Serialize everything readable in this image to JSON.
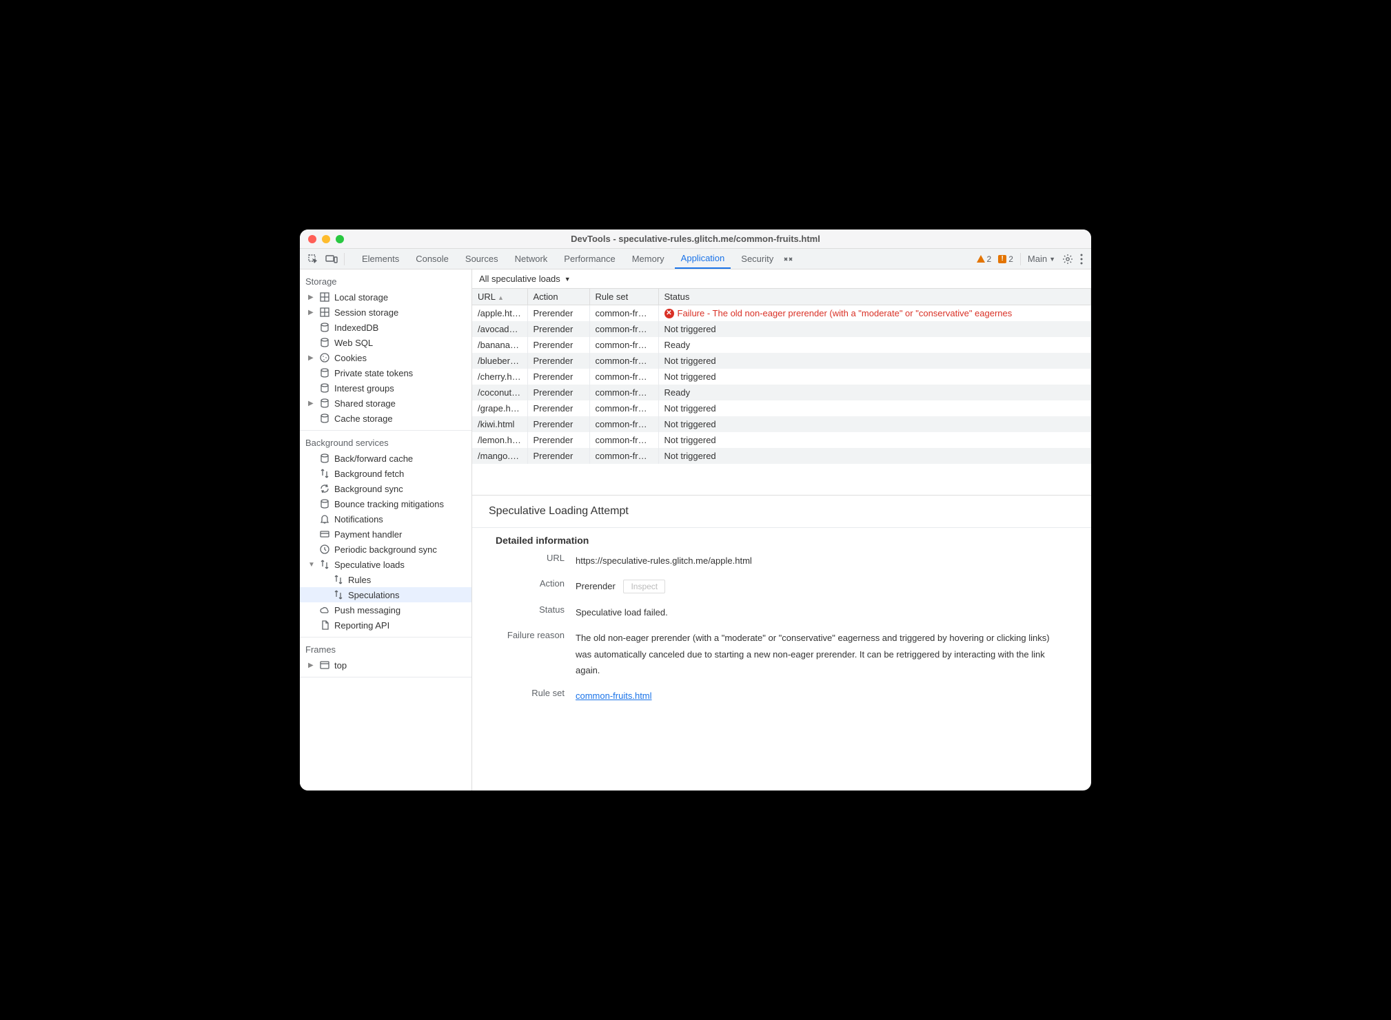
{
  "window_title": "DevTools - speculative-rules.glitch.me/common-fruits.html",
  "tabs": [
    "Elements",
    "Console",
    "Sources",
    "Network",
    "Performance",
    "Memory",
    "Application",
    "Security"
  ],
  "active_tab": "Application",
  "toolbar_right": {
    "warn_count": "2",
    "error_count": "2",
    "target": "Main"
  },
  "sidebar_sections": {
    "storage": {
      "title": "Storage",
      "items": [
        {
          "label": "Local storage",
          "icon": "grid",
          "expandable": true
        },
        {
          "label": "Session storage",
          "icon": "grid",
          "expandable": true
        },
        {
          "label": "IndexedDB",
          "icon": "db"
        },
        {
          "label": "Web SQL",
          "icon": "db"
        },
        {
          "label": "Cookies",
          "icon": "cookie",
          "expandable": true
        },
        {
          "label": "Private state tokens",
          "icon": "db"
        },
        {
          "label": "Interest groups",
          "icon": "db"
        },
        {
          "label": "Shared storage",
          "icon": "db",
          "expandable": true
        },
        {
          "label": "Cache storage",
          "icon": "db"
        }
      ]
    },
    "background": {
      "title": "Background services",
      "items": [
        {
          "label": "Back/forward cache",
          "icon": "db"
        },
        {
          "label": "Background fetch",
          "icon": "updown"
        },
        {
          "label": "Background sync",
          "icon": "sync"
        },
        {
          "label": "Bounce tracking mitigations",
          "icon": "db"
        },
        {
          "label": "Notifications",
          "icon": "bell"
        },
        {
          "label": "Payment handler",
          "icon": "card"
        },
        {
          "label": "Periodic background sync",
          "icon": "clock"
        },
        {
          "label": "Speculative loads",
          "icon": "updown",
          "expandable": true,
          "expanded": true
        },
        {
          "label": "Rules",
          "icon": "updown",
          "nested": true
        },
        {
          "label": "Speculations",
          "icon": "updown",
          "nested": true,
          "selected": true
        },
        {
          "label": "Push messaging",
          "icon": "cloud"
        },
        {
          "label": "Reporting API",
          "icon": "doc"
        }
      ]
    },
    "frames": {
      "title": "Frames",
      "items": [
        {
          "label": "top",
          "icon": "window",
          "expandable": true
        }
      ]
    }
  },
  "filter": "All speculative loads",
  "table": {
    "headers": [
      "URL",
      "Action",
      "Rule set",
      "Status"
    ],
    "rows": [
      {
        "url": "/apple.html",
        "action": "Prerender",
        "ruleset": "common-fr…",
        "status": "Failure - The old non-eager prerender (with a \"moderate\" or \"conservative\" eagernes",
        "failed": true
      },
      {
        "url": "/avocad…",
        "action": "Prerender",
        "ruleset": "common-fr…",
        "status": "Not triggered"
      },
      {
        "url": "/banana.…",
        "action": "Prerender",
        "ruleset": "common-fr…",
        "status": "Ready"
      },
      {
        "url": "/blueberr…",
        "action": "Prerender",
        "ruleset": "common-fr…",
        "status": "Not triggered"
      },
      {
        "url": "/cherry.h…",
        "action": "Prerender",
        "ruleset": "common-fr…",
        "status": "Not triggered"
      },
      {
        "url": "/coconut…",
        "action": "Prerender",
        "ruleset": "common-fr…",
        "status": "Ready"
      },
      {
        "url": "/grape.html",
        "action": "Prerender",
        "ruleset": "common-fr…",
        "status": "Not triggered"
      },
      {
        "url": "/kiwi.html",
        "action": "Prerender",
        "ruleset": "common-fr…",
        "status": "Not triggered"
      },
      {
        "url": "/lemon.h…",
        "action": "Prerender",
        "ruleset": "common-fr…",
        "status": "Not triggered"
      },
      {
        "url": "/mango.…",
        "action": "Prerender",
        "ruleset": "common-fr…",
        "status": "Not triggered"
      }
    ]
  },
  "detail": {
    "title": "Speculative Loading Attempt",
    "subtitle": "Detailed information",
    "url_label": "URL",
    "url": "https://speculative-rules.glitch.me/apple.html",
    "action_label": "Action",
    "action": "Prerender",
    "inspect": "Inspect",
    "status_label": "Status",
    "status": "Speculative load failed.",
    "failure_label": "Failure reason",
    "failure": "The old non-eager prerender (with a \"moderate\" or \"conservative\" eagerness and triggered by hovering or clicking links) was automatically canceled due to starting a new non-eager prerender. It can be retriggered by interacting with the link again.",
    "ruleset_label": "Rule set",
    "ruleset": "common-fruits.html"
  }
}
